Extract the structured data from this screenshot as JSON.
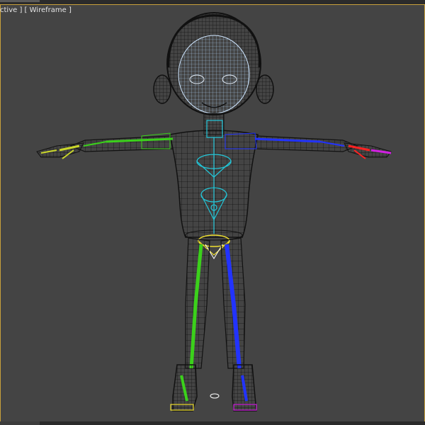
{
  "viewport": {
    "label_prefix": "ctive ]",
    "label_mode": "[ Wireframe ]",
    "background": "#444444",
    "active_border_color": "#c9a13b"
  },
  "figure": {
    "mesh_color": "#111111",
    "head_highlight": "#cfe6ff",
    "colors": {
      "left_side_bones": "#3bd11b",
      "right_side_bones": "#2233ff",
      "spine_bones": "#22c7d9",
      "pelvis_bones": "#f0e030",
      "left_hand": "#c9d62a",
      "right_hand_red": "#ff2222",
      "right_hand_magenta": "#d020e0"
    }
  }
}
